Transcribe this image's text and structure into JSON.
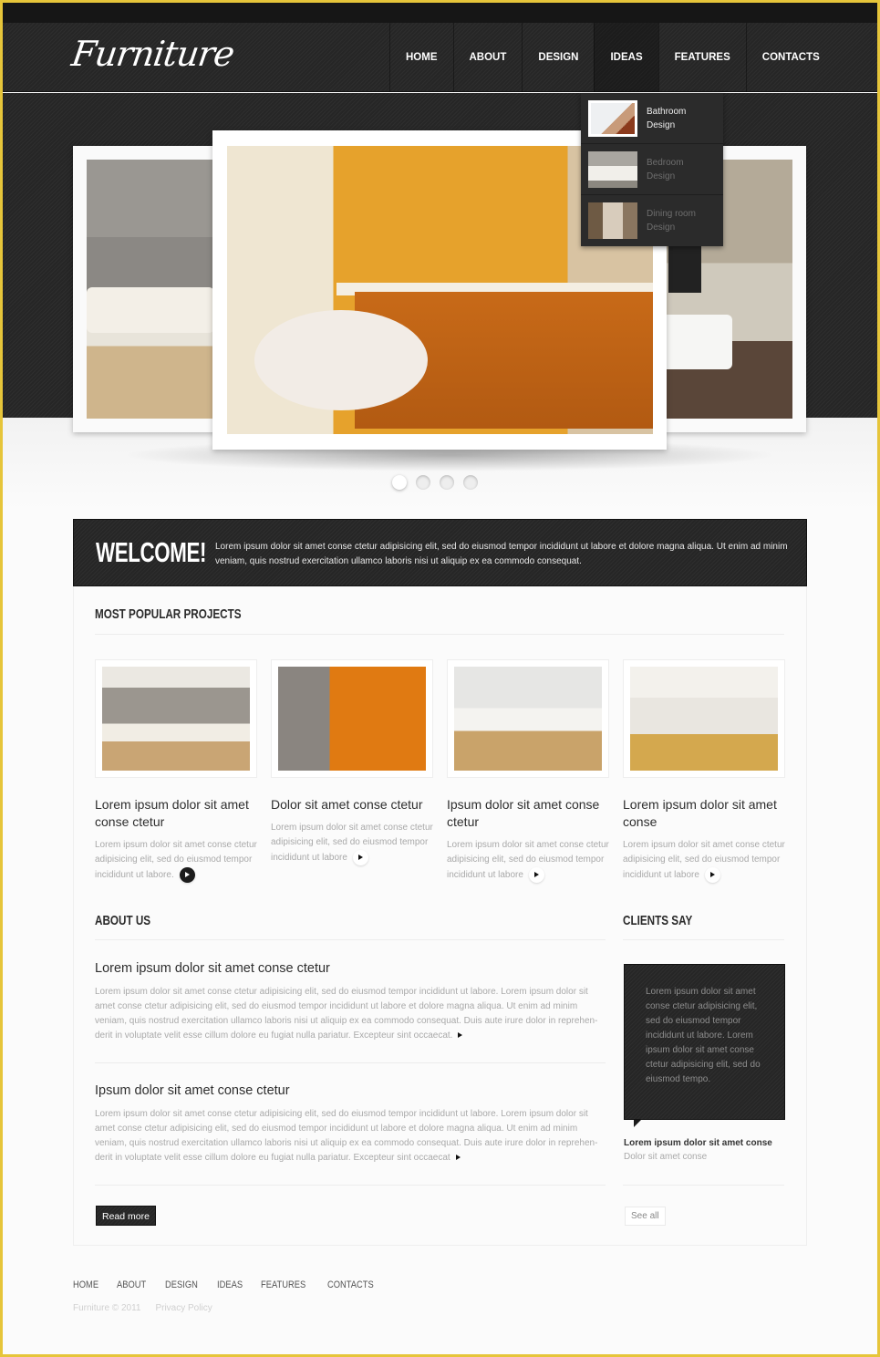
{
  "header": {
    "logo": "Furniture",
    "nav": [
      {
        "label": "HOME"
      },
      {
        "label": "ABOUT"
      },
      {
        "label": "DESIGN"
      },
      {
        "label": "IDEAS",
        "active": true
      },
      {
        "label": "FEATURES"
      },
      {
        "label": "CONTACTS"
      }
    ],
    "dropdown": [
      {
        "label": "Bathroom Design",
        "active": true,
        "thumb_color": "#d9cdbf"
      },
      {
        "label": "Bedroom Design",
        "active": false,
        "thumb_color": "#b8b6b2"
      },
      {
        "label": "Dining room Design",
        "active": false,
        "thumb_color": "#8a7660"
      }
    ]
  },
  "slider": {
    "slides": [
      {
        "name": "living-room",
        "color": "#9a9792"
      },
      {
        "name": "kitchen",
        "color": "#e6a22c"
      },
      {
        "name": "lounge",
        "color": "#b4aa98"
      }
    ],
    "total": 4,
    "active_index": 0
  },
  "welcome": {
    "title": "WELCOME!",
    "text": "Lorem ipsum dolor sit amet conse ctetur adipisicing elit, sed do eiusmod tempor incididunt ut labore et dolore magna aliqua. Ut enim ad minim veniam, quis nostrud exercitation ullamco laboris nisi ut aliquip ex ea commodo consequat."
  },
  "projects": {
    "title": "MOST POPULAR PROJECTS",
    "items": [
      {
        "title": "Lorem ipsum dolor sit amet conse ctetur",
        "text": "Lorem ipsum dolor sit amet conse ctetur adipisicing elit, sed do eiusmod tempor incididunt ut labore.",
        "image_colors": [
          "#ebe8e2",
          "#9b968f",
          "#c9a574"
        ],
        "active": true
      },
      {
        "title": "Dolor sit amet conse ctetur",
        "text": "Lorem ipsum dolor sit amet conse ctetur adipisicing elit, sed do eiusmod tempor incididunt ut labore",
        "image_colors": [
          "#7a7470",
          "#e07a12",
          "#3a3634"
        ],
        "active": false
      },
      {
        "title": "Ipsum dolor sit amet conse ctetur",
        "text": "Lorem ipsum dolor sit amet conse ctetur adipisicing elit, sed do eiusmod tempor incididunt ut labore",
        "image_colors": [
          "#e6e6e4",
          "#f4f3f0",
          "#c9a36a"
        ],
        "active": false
      },
      {
        "title": "Lorem ipsum dolor sit amet conse",
        "text": "Lorem ipsum dolor sit amet conse ctetur adipisicing elit, sed do eiusmod tempor incididunt ut labore",
        "image_colors": [
          "#f3f1ec",
          "#e9e6e0",
          "#d4a84e"
        ],
        "active": false
      }
    ]
  },
  "about": {
    "title": "ABOUT US",
    "items": [
      {
        "title": "Lorem ipsum dolor sit amet conse ctetur",
        "text": "Lorem ipsum dolor sit amet conse ctetur adipisicing elit, sed do eiusmod tempor incididunt ut labore. Lorem ipsum dolor sit amet conse ctetur adipisicing elit, sed do eiusmod tempor incididunt ut labore et dolore magna aliqua. Ut enim ad minim veniam, quis nostrud exercitation ullamco laboris nisi ut aliquip ex ea commodo consequat. Duis aute irure dolor in reprehen-derit in voluptate velit esse cillum dolore eu fugiat nulla pariatur. Excepteur sint occaecat."
      },
      {
        "title": "Ipsum dolor sit amet conse ctetur",
        "text": "Lorem ipsum dolor sit amet conse ctetur adipisicing elit, sed do eiusmod tempor incididunt ut labore. Lorem ipsum dolor sit amet conse ctetur adipisicing elit, sed do eiusmod tempor incididunt ut labore et dolore magna aliqua. Ut enim ad minim veniam, quis nostrud exercitation ullamco laboris nisi ut aliquip ex ea commodo consequat. Duis aute irure dolor in reprehen-derit in voluptate velit esse cillum dolore eu fugiat nulla pariatur. Excepteur sint occaecat"
      }
    ],
    "read_more": "Read more"
  },
  "clients": {
    "title": "CLIENTS SAY",
    "quote": "Lorem ipsum dolor sit amet conse ctetur adipisicing elit, sed do eiusmod tempor incididunt ut labore. Lorem ipsum dolor sit amet conse ctetur adipisicing elit, sed do eiusmod tempo.",
    "author": "Lorem ipsum dolor sit amet conse",
    "role": "Dolor sit amet conse",
    "see_all": "See all"
  },
  "footer": {
    "nav": [
      "HOME",
      "ABOUT",
      "DESIGN",
      "IDEAS",
      "FEATURES",
      "CONTACTS"
    ],
    "copyright": "Furniture © 2011",
    "privacy": "Privacy Policy"
  },
  "colors": {
    "frame_border": "#e6c53a",
    "dark_bg": "#262626",
    "page_bg": "#fbfbfb"
  }
}
